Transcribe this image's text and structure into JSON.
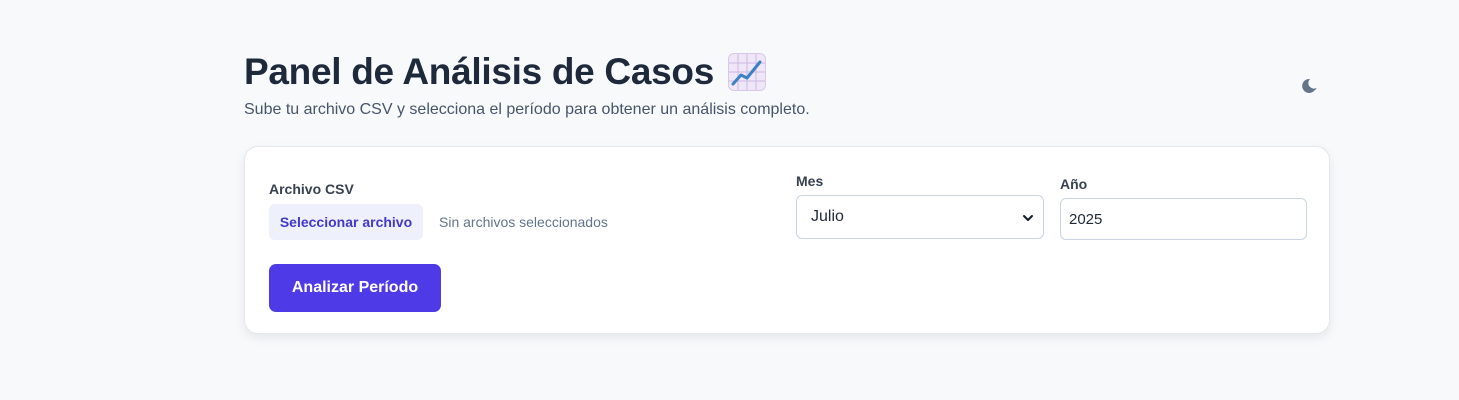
{
  "header": {
    "title": "Panel de Análisis de Casos",
    "title_icon": "chart-increasing-icon",
    "subtitle": "Sube tu archivo CSV y selecciona el período para obtener un análisis completo."
  },
  "theme_toggle": {
    "icon": "moon-icon"
  },
  "form": {
    "file_label": "Archivo CSV",
    "file_button_label": "Seleccionar archivo",
    "file_status": "Sin archivos seleccionados",
    "month_label": "Mes",
    "month_value": "Julio",
    "year_label": "Año",
    "year_value": "2025",
    "submit_label": "Analizar Período"
  },
  "colors": {
    "primary": "#4f3ae8",
    "file_button_bg": "#eef0fb",
    "file_button_text": "#4338ca",
    "page_bg": "#f8f9fb"
  }
}
